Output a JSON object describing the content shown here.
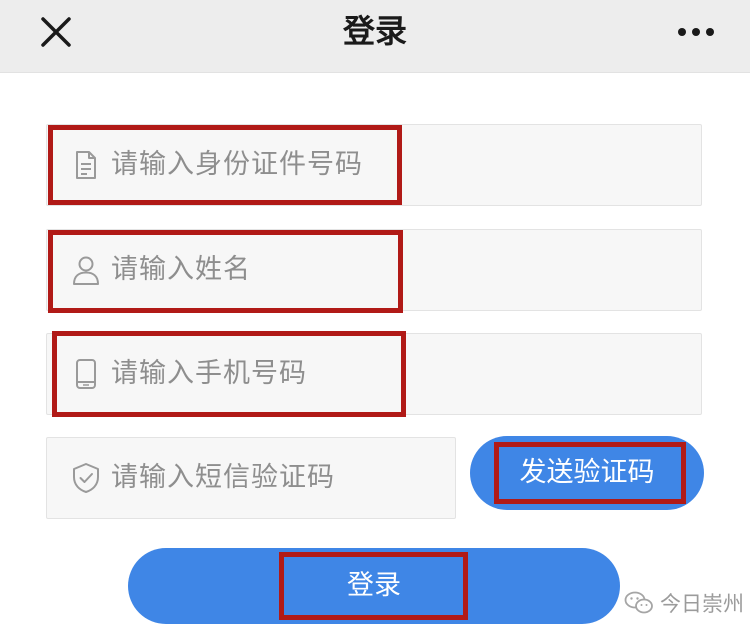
{
  "header": {
    "title": "登录",
    "close_icon": "close-icon",
    "more_icon": "more-icon"
  },
  "form": {
    "id_number": {
      "placeholder": "请输入身份证件号码",
      "value": "",
      "icon": "document-icon"
    },
    "name": {
      "placeholder": "请输入姓名",
      "value": "",
      "icon": "user-icon"
    },
    "phone": {
      "placeholder": "请输入手机号码",
      "value": "",
      "icon": "phone-icon"
    },
    "sms_code": {
      "placeholder": "请输入短信验证码",
      "value": "",
      "icon": "shield-check-icon"
    },
    "send_code_label": "发送验证码",
    "login_label": "登录"
  },
  "watermark": {
    "text": "今日崇州"
  },
  "colors": {
    "primary_button": "#3f86e6",
    "highlight_box": "#b11a17",
    "header_bg": "#ededed",
    "field_bg": "#f7f7f7",
    "placeholder_text": "#8e8e8e"
  }
}
